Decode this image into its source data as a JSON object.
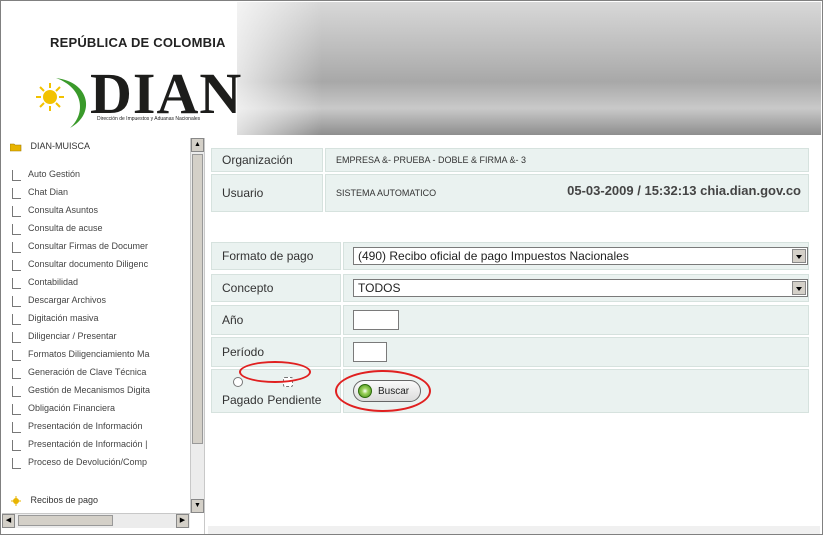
{
  "header": {
    "country": "REPÚBLICA DE COLOMBIA",
    "logo_text": "DIAN",
    "logo_subtitle": "Dirección de Impuestos y Aduanas Nacionales"
  },
  "sidebar": {
    "root_label": "DIAN-MUISCA",
    "items": [
      {
        "label": "Auto Gestión"
      },
      {
        "label": "Chat Dian"
      },
      {
        "label": "Consulta Asuntos"
      },
      {
        "label": "Consulta de acuse"
      },
      {
        "label": "Consultar Firmas de Documer"
      },
      {
        "label": "Consultar documento Diligenc"
      },
      {
        "label": "Contabilidad"
      },
      {
        "label": "Descargar Archivos"
      },
      {
        "label": "Digitación masiva"
      },
      {
        "label": "Diligenciar / Presentar"
      },
      {
        "label": "Formatos Diligenciamiento Ma"
      },
      {
        "label": "Generación de Clave Técnica"
      },
      {
        "label": "Gestión de Mecanismos Digita"
      },
      {
        "label": "Obligación Financiera"
      },
      {
        "label": "Presentación de Información"
      },
      {
        "label": "Presentación de Información |"
      },
      {
        "label": "Proceso de Devolución/Comp"
      }
    ],
    "last_folder_label": "Recibos de pago"
  },
  "info": {
    "org_label": "Organización",
    "org_value": "EMPRESA &- PRUEBA - DOBLE & FIRMA &- 3",
    "user_label": "Usuario",
    "user_value": "SISTEMA AUTOMATICO",
    "datetime_host": "05-03-2009 / 15:32:13 chia.dian.gov.co"
  },
  "form": {
    "formato_label": "Formato de pago",
    "formato_value": "(490) Recibo oficial de pago Impuestos Nacionales",
    "concepto_label": "Concepto",
    "concepto_value": "TODOS",
    "anio_label": "Año",
    "anio_value": "",
    "periodo_label": "Período",
    "periodo_value": "",
    "pagado_label": "Pagado",
    "pendiente_label": "Pendiente",
    "search_button": "Buscar"
  },
  "colors": {
    "label_bg": "#eaf2f0",
    "annotation": "#e02020"
  }
}
